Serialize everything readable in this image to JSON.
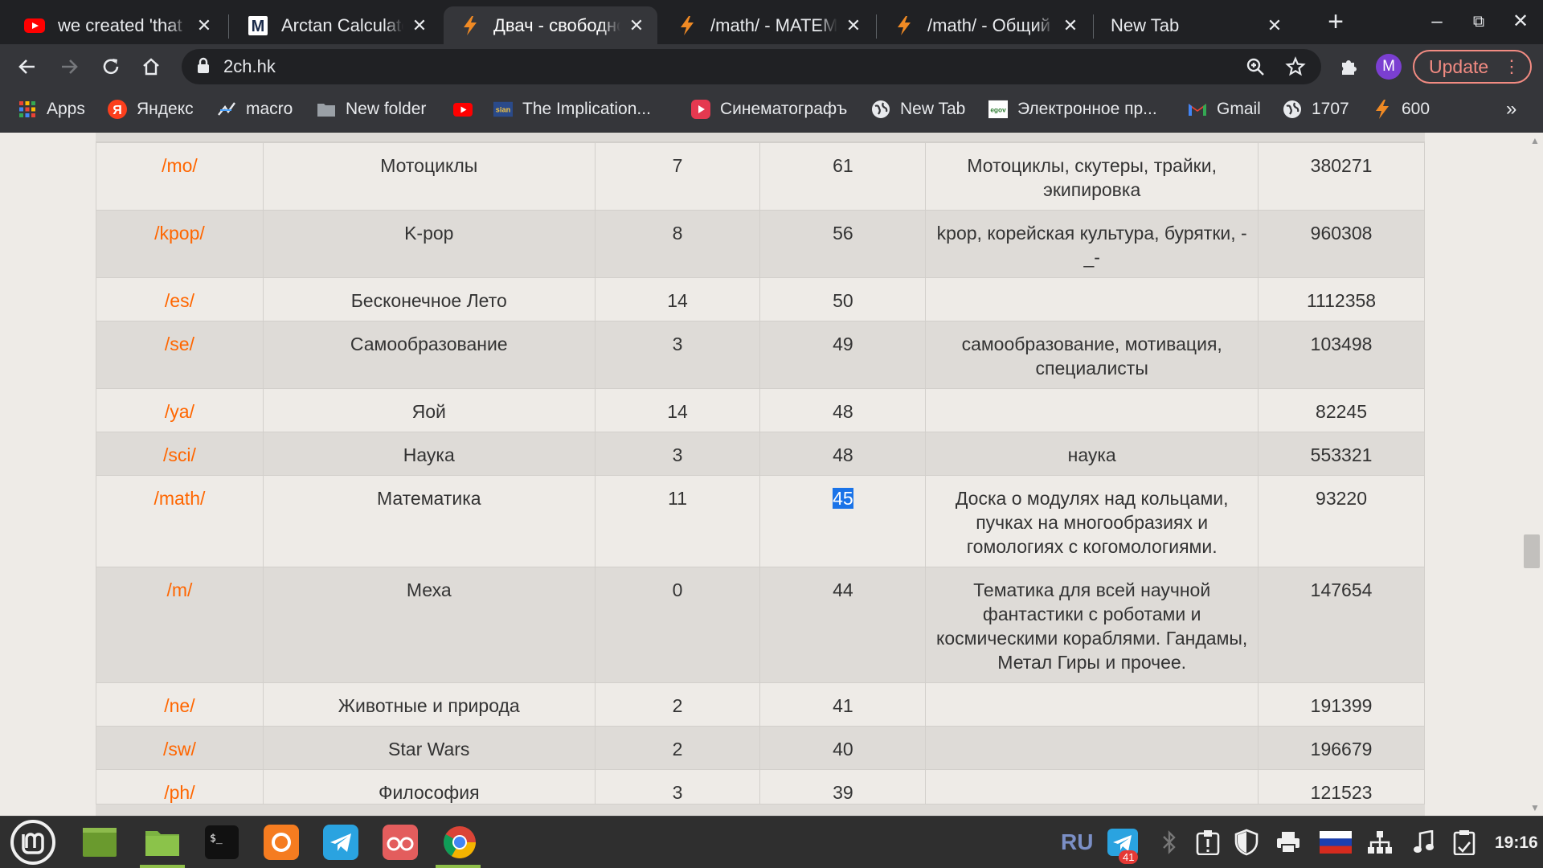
{
  "tabs": [
    {
      "title": "we created 'that g",
      "icon": "youtube-icon",
      "active": false
    },
    {
      "title": "Arctan Calculator",
      "icon": "m-logo-icon",
      "active": false
    },
    {
      "title": "Двач - свободное",
      "icon": "lightning-icon",
      "active": true
    },
    {
      "title": "/math/ - МАТЕМА",
      "icon": "lightning-icon",
      "active": false
    },
    {
      "title": "/math/ - Общий т",
      "icon": "lightning-icon",
      "active": false
    },
    {
      "title": "New Tab",
      "icon": "",
      "active": false
    }
  ],
  "address": {
    "url": "2ch.hk"
  },
  "profile": {
    "initial": "M"
  },
  "update_label": "Update",
  "bookmarks": [
    {
      "label": "Apps",
      "icon": "apps-grid-icon"
    },
    {
      "label": "Яндекс",
      "icon": "yandex-icon"
    },
    {
      "label": "macro",
      "icon": "macro-icon"
    },
    {
      "label": "New folder",
      "icon": "folder-icon"
    },
    {
      "label": "",
      "icon": "youtube-icon"
    },
    {
      "label": "The Implication...",
      "icon": "sian-icon"
    },
    {
      "label": "Синематографъ",
      "icon": "cinema-icon"
    },
    {
      "label": "New Tab",
      "icon": "globe-icon"
    },
    {
      "label": "Электронное пр...",
      "icon": "egov-icon"
    },
    {
      "label": "Gmail",
      "icon": "gmail-icon"
    },
    {
      "label": "1707",
      "icon": "globe-icon"
    },
    {
      "label": "600",
      "icon": "lightning-icon"
    }
  ],
  "boards": {
    "rows": [
      {
        "board": "/mo/",
        "name": "Мотоциклы",
        "speed": "7",
        "posts": "61",
        "desc": "Мотоциклы, скутеры, трайки, экипировка",
        "total": "380271"
      },
      {
        "board": "/kpop/",
        "name": "K-pop",
        "speed": "8",
        "posts": "56",
        "desc": "kpop, корейская культура, бурятки, -_-",
        "total": "960308"
      },
      {
        "board": "/es/",
        "name": "Бесконечное Лето",
        "speed": "14",
        "posts": "50",
        "desc": "",
        "total": "1112358"
      },
      {
        "board": "/se/",
        "name": "Самообразование",
        "speed": "3",
        "posts": "49",
        "desc": "самообразование, мотивация, специалисты",
        "total": "103498"
      },
      {
        "board": "/ya/",
        "name": "Яой",
        "speed": "14",
        "posts": "48",
        "desc": "",
        "total": "82245"
      },
      {
        "board": "/sci/",
        "name": "Наука",
        "speed": "3",
        "posts": "48",
        "desc": "наука",
        "total": "553321"
      },
      {
        "board": "/math/",
        "name": "Математика",
        "speed": "11",
        "posts": "45",
        "desc": "Доска о модулях над кольцами, пучках на многообразиях и гомологиях с когомологиями.",
        "total": "93220"
      },
      {
        "board": "/m/",
        "name": "Меха",
        "speed": "0",
        "posts": "44",
        "desc": "Тематика для всей научной фантастики с роботами и космическими кораблями. Гандамы, Метал Гиры и прочее.",
        "total": "147654"
      },
      {
        "board": "/ne/",
        "name": "Животные и природа",
        "speed": "2",
        "posts": "41",
        "desc": "",
        "total": "191399"
      },
      {
        "board": "/sw/",
        "name": "Star Wars",
        "speed": "2",
        "posts": "40",
        "desc": "",
        "total": "196679"
      },
      {
        "board": "/ph/",
        "name": "Философия",
        "speed": "3",
        "posts": "39",
        "desc": "",
        "total": "121523"
      }
    ],
    "selected_row": 6
  },
  "taskbar": {
    "language": "RU",
    "telegram_badge": "41",
    "clock": "19:16"
  },
  "colors": {
    "board_link": "#ff6600",
    "selection": "#1a73e8",
    "update_accent": "#f28b82"
  }
}
